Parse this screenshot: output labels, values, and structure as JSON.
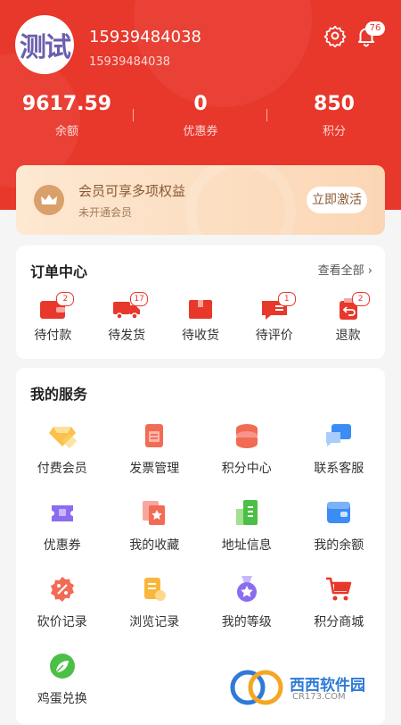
{
  "profile": {
    "avatar_text": "测试",
    "name": "15939484038",
    "sub": "15939484038",
    "notification_count": "76"
  },
  "stats": [
    {
      "value": "9617.59",
      "label": "余额"
    },
    {
      "value": "0",
      "label": "优惠券"
    },
    {
      "value": "850",
      "label": "积分"
    }
  ],
  "vip": {
    "title": "会员可享多项权益",
    "subtitle": "未开通会员",
    "button": "立即激活"
  },
  "orders": {
    "title": "订单中心",
    "see_all": "查看全部",
    "items": [
      {
        "label": "待付款",
        "badge": "2",
        "icon": "wallet-icon"
      },
      {
        "label": "待发货",
        "badge": "17",
        "icon": "truck-icon"
      },
      {
        "label": "待收货",
        "badge": "",
        "icon": "package-icon"
      },
      {
        "label": "待评价",
        "badge": "1",
        "icon": "comment-icon"
      },
      {
        "label": "退款",
        "badge": "2",
        "icon": "refund-icon"
      }
    ]
  },
  "services": {
    "title": "我的服务",
    "items": [
      {
        "label": "付费会员",
        "icon": "diamond-icon"
      },
      {
        "label": "发票管理",
        "icon": "invoice-icon"
      },
      {
        "label": "积分中心",
        "icon": "coins-icon"
      },
      {
        "label": "联系客服",
        "icon": "chat-icon"
      },
      {
        "label": "优惠券",
        "icon": "ticket-icon"
      },
      {
        "label": "我的收藏",
        "icon": "star-card-icon"
      },
      {
        "label": "地址信息",
        "icon": "building-icon"
      },
      {
        "label": "我的余额",
        "icon": "wallet-blue-icon"
      },
      {
        "label": "砍价记录",
        "icon": "percent-icon"
      },
      {
        "label": "浏览记录",
        "icon": "history-icon"
      },
      {
        "label": "我的等级",
        "icon": "medal-icon"
      },
      {
        "label": "积分商城",
        "icon": "cart-icon"
      },
      {
        "label": "鸡蛋兑换",
        "icon": "leaf-icon"
      }
    ]
  },
  "watermark": {
    "brand": "西西软件园",
    "url": "CR173.COM"
  },
  "colors": {
    "primary": "#e8372b",
    "vip_gold": "#d9a06a",
    "background": "#f5f5f5"
  }
}
